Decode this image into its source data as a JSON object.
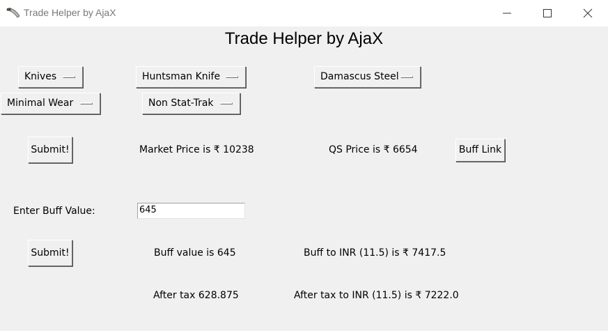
{
  "window": {
    "title": "Trade Helper by AjaX",
    "icon": "knife-icon",
    "controls": [
      "minimize-icon",
      "maximize-icon",
      "close-icon"
    ]
  },
  "heading": "Trade Helper by AjaX",
  "selectors": {
    "category": "Knives",
    "item": "Huntsman Knife",
    "skin": "Damascus Steel",
    "wear": "Minimal Wear",
    "stattrak": "Non Stat-Trak"
  },
  "price_section": {
    "submit_label": "Submit!",
    "market_price": "Market Price is ₹ 10238",
    "qs_price": "QS Price is ₹ 6654",
    "buff_link_label": "Buff Link"
  },
  "buff_section": {
    "input_label": "Enter Buff Value:",
    "input_value": "645",
    "submit_label": "Submit!",
    "buff_value": "Buff value is 645",
    "buff_to_inr": "Buff to INR (11.5) is ₹ 7417.5",
    "after_tax": "After tax 628.875",
    "after_tax_inr": "After tax to INR (11.5) is ₹ 7222.0"
  }
}
